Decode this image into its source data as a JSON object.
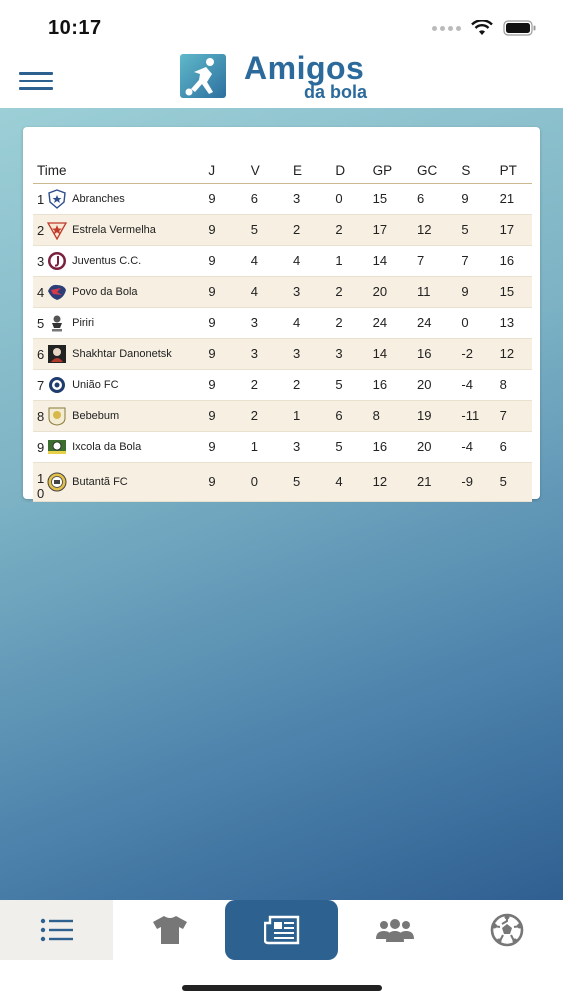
{
  "status": {
    "time": "10:17"
  },
  "header": {
    "brand_big": "Amigos",
    "brand_small": "da bola"
  },
  "table": {
    "headers": [
      "Time",
      "J",
      "V",
      "E",
      "D",
      "GP",
      "GC",
      "S",
      "PT"
    ],
    "rows": [
      {
        "pos": "1",
        "team": "Abranches",
        "crest": "abranches-crest-icon",
        "j": "9",
        "v": "6",
        "e": "3",
        "d": "0",
        "gp": "15",
        "gc": "6",
        "s": "9",
        "pt": "21"
      },
      {
        "pos": "2",
        "team": "Estrela Vermelha",
        "crest": "estrela-vermelha-crest-icon",
        "j": "9",
        "v": "5",
        "e": "2",
        "d": "2",
        "gp": "17",
        "gc": "12",
        "s": "5",
        "pt": "17"
      },
      {
        "pos": "3",
        "team": "Juventus C.C.",
        "crest": "juventus-crest-icon",
        "j": "9",
        "v": "4",
        "e": "4",
        "d": "1",
        "gp": "14",
        "gc": "7",
        "s": "7",
        "pt": "16"
      },
      {
        "pos": "4",
        "team": "Povo da Bola",
        "crest": "povo-da-bola-crest-icon",
        "j": "9",
        "v": "4",
        "e": "3",
        "d": "2",
        "gp": "20",
        "gc": "11",
        "s": "9",
        "pt": "15"
      },
      {
        "pos": "5",
        "team": "Piriri",
        "crest": "piriri-crest-icon",
        "j": "9",
        "v": "3",
        "e": "4",
        "d": "2",
        "gp": "24",
        "gc": "24",
        "s": "0",
        "pt": "13"
      },
      {
        "pos": "6",
        "team": "Shakhtar Danonetsk",
        "crest": "shakhtar-crest-icon",
        "j": "9",
        "v": "3",
        "e": "3",
        "d": "3",
        "gp": "14",
        "gc": "16",
        "s": "-2",
        "pt": "12"
      },
      {
        "pos": "7",
        "team": "União FC",
        "crest": "uniao-fc-crest-icon",
        "j": "9",
        "v": "2",
        "e": "2",
        "d": "5",
        "gp": "16",
        "gc": "20",
        "s": "-4",
        "pt": "8"
      },
      {
        "pos": "8",
        "team": "Bebebum",
        "crest": "bebebum-crest-icon",
        "j": "9",
        "v": "2",
        "e": "1",
        "d": "6",
        "gp": "8",
        "gc": "19",
        "s": "-11",
        "pt": "7"
      },
      {
        "pos": "9",
        "team": "Ixcola da Bola",
        "crest": "ixcola-crest-icon",
        "j": "9",
        "v": "1",
        "e": "3",
        "d": "5",
        "gp": "16",
        "gc": "20",
        "s": "-4",
        "pt": "6"
      },
      {
        "pos": "10",
        "team": "Butantã FC",
        "crest": "butanta-crest-icon",
        "j": "9",
        "v": "0",
        "e": "5",
        "d": "4",
        "gp": "12",
        "gc": "21",
        "s": "-9",
        "pt": "5"
      }
    ]
  },
  "tabs": [
    {
      "icon": "list-icon"
    },
    {
      "icon": "shirt-icon"
    },
    {
      "icon": "newspaper-icon"
    },
    {
      "icon": "group-icon"
    },
    {
      "icon": "soccer-ball-icon"
    }
  ],
  "colors": {
    "brand": "#2d6190",
    "active_tab": "#2d6190"
  }
}
